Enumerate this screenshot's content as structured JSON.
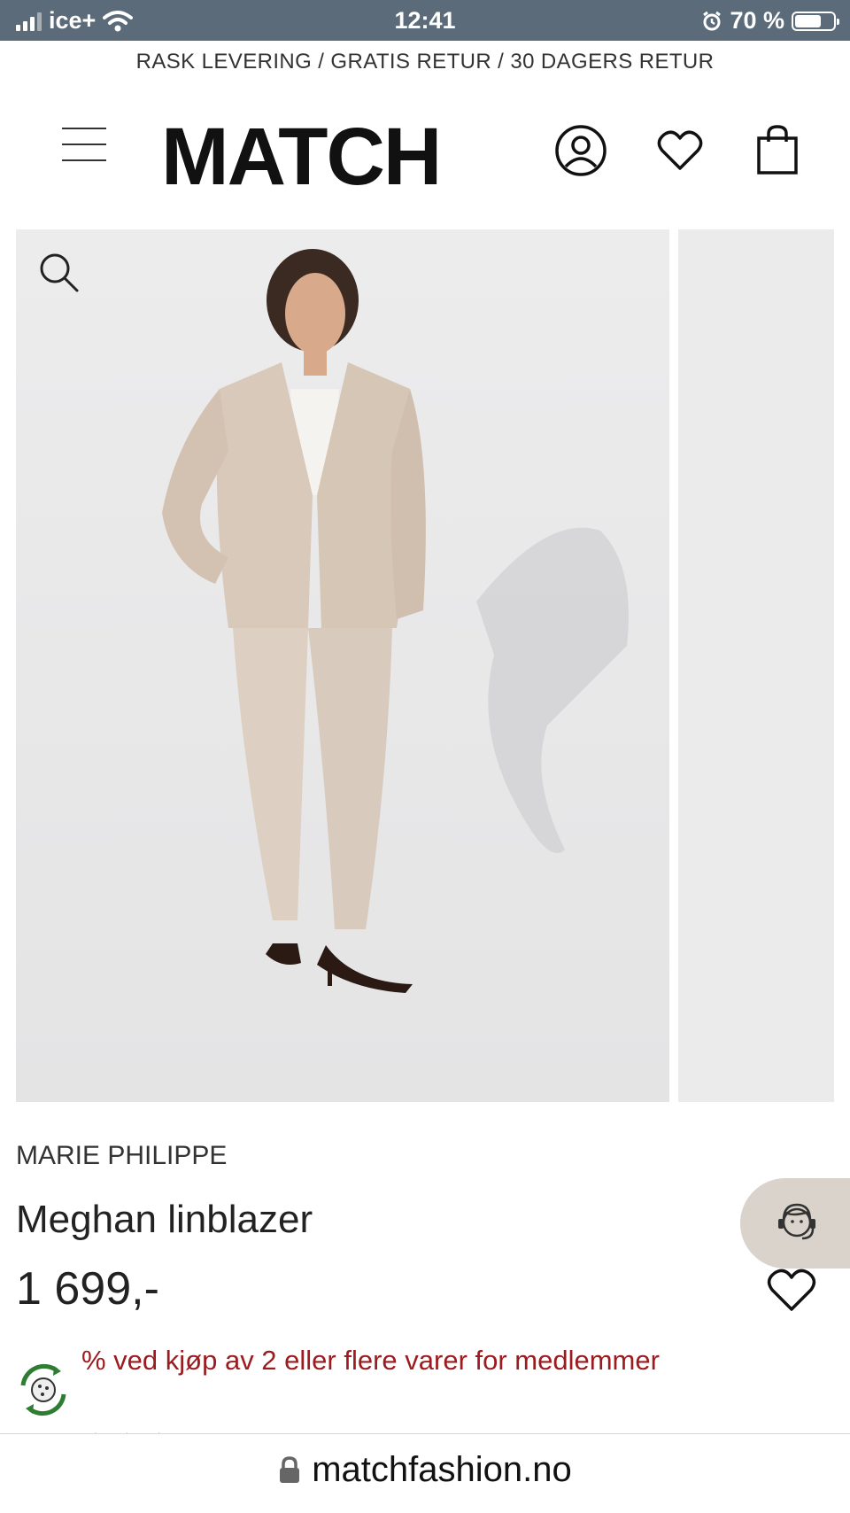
{
  "status_bar": {
    "carrier": "ice+",
    "time": "12:41",
    "battery": "70 %",
    "battery_level": 0.7
  },
  "promo_banner": "RASK LEVERING / GRATIS RETUR / 30 DAGERS RETUR",
  "header": {
    "logo": "MATCH",
    "icons": [
      "menu-icon",
      "account-icon",
      "heart-icon",
      "bag-icon"
    ]
  },
  "product": {
    "brand": "MARIE PHILIPPE",
    "name": "Meghan linblazer",
    "price": "1 699,-",
    "member_offer": "% ved kjøp av 2 eller flere varer for medlemmer"
  },
  "browser": {
    "url": "matchfashion.no"
  },
  "colors": {
    "status_bar": "#5b6b79",
    "offer_red": "#9b1b1e",
    "support_bg": "#d9d3cc",
    "eco_green": "#2e7d32"
  }
}
